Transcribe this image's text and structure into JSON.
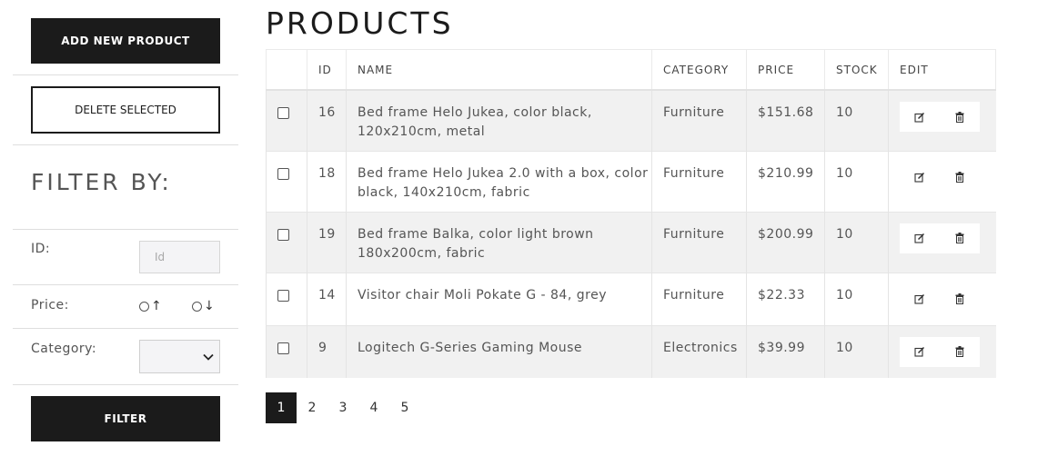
{
  "sidebar": {
    "add_button": "ADD NEW PRODUCT",
    "delete_button": "DELETE SELECTED",
    "filter_title": "FILTER BY:",
    "id_label": "ID:",
    "id_placeholder": "Id",
    "price_label": "Price:",
    "price_asc": "↑",
    "price_desc": "↓",
    "category_label": "Category:",
    "category_value": "",
    "filter_button": "FILTER"
  },
  "main": {
    "title": "PRODUCTS",
    "columns": [
      "",
      "ID",
      "NAME",
      "CATEGORY",
      "PRICE",
      "STOCK",
      "EDIT"
    ],
    "rows": [
      {
        "id": "16",
        "name": "Bed frame Helo Jukea, color black, 120x210cm, metal",
        "category": "Furniture",
        "price": "$151.68",
        "stock": "10"
      },
      {
        "id": "18",
        "name": "Bed frame Helo Jukea 2.0 with a box, color black, 140x210cm, fabric",
        "category": "Furniture",
        "price": "$210.99",
        "stock": "10"
      },
      {
        "id": "19",
        "name": "Bed frame Balka, color light brown 180x200cm, fabric",
        "category": "Furniture",
        "price": "$200.99",
        "stock": "10"
      },
      {
        "id": "14",
        "name": "Visitor chair Moli Pokate G - 84, grey",
        "category": "Furniture",
        "price": "$22.33",
        "stock": "10"
      },
      {
        "id": "9",
        "name": "Logitech G-Series Gaming Mouse",
        "category": "Electronics",
        "price": "$39.99",
        "stock": "10"
      }
    ],
    "pagination": [
      "1",
      "2",
      "3",
      "4",
      "5"
    ],
    "active_page": "1"
  },
  "icons": {
    "edit": "edit-icon",
    "delete": "trash-icon",
    "chevron": "chevron-down-icon"
  }
}
